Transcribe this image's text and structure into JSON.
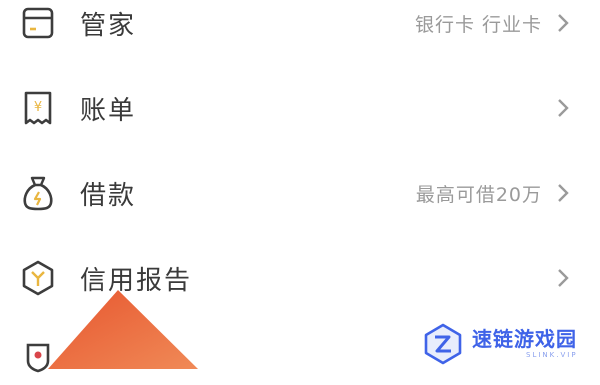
{
  "menu": {
    "items": [
      {
        "label": "管家",
        "right_text": "银行卡 行业卡",
        "icon": "wallet-card-icon"
      },
      {
        "label": "账单",
        "right_text": "",
        "icon": "receipt-yen-icon"
      },
      {
        "label": "借款",
        "right_text": "最高可借20万",
        "icon": "money-bag-icon"
      },
      {
        "label": "信用报告",
        "right_text": "",
        "icon": "hexagon-report-icon"
      },
      {
        "label": "",
        "right_text": "",
        "icon": "badge-icon"
      }
    ]
  },
  "watermark": {
    "title": "速链游戏园",
    "subtitle": "SLINK.VIP"
  },
  "colors": {
    "icon_stroke": "#3d3d3d",
    "icon_accent": "#e9b640",
    "label": "#3a3a3a",
    "secondary": "#9a9a9a",
    "arrow_start": "#e7562f",
    "arrow_end": "#f08a57",
    "watermark_blue": "#3f63e8"
  }
}
